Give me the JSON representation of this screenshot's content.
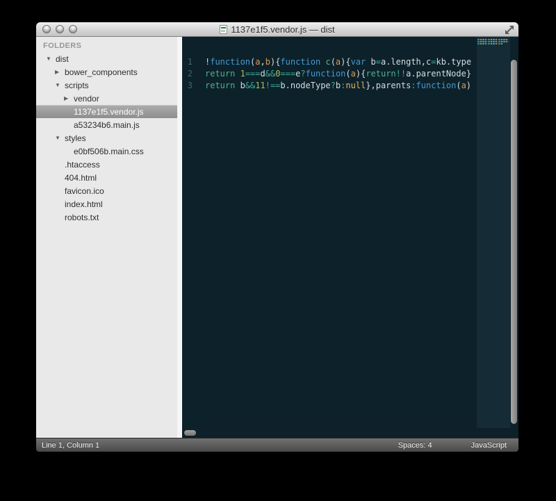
{
  "window": {
    "title": "1137e1f5.vendor.js — dist",
    "traffic_lights": [
      "close",
      "minimize",
      "zoom"
    ]
  },
  "sidebar": {
    "header": "FOLDERS",
    "items": [
      {
        "label": "dist",
        "level": 1,
        "type": "folder",
        "state": "expanded",
        "selected": false
      },
      {
        "label": "bower_components",
        "level": 2,
        "type": "folder",
        "state": "collapsed",
        "selected": false
      },
      {
        "label": "scripts",
        "level": 2,
        "type": "folder",
        "state": "expanded",
        "selected": false
      },
      {
        "label": "vendor",
        "level": 3,
        "type": "folder",
        "state": "collapsed",
        "selected": false
      },
      {
        "label": "1137e1f5.vendor.js",
        "level": 3,
        "type": "file",
        "state": "none",
        "selected": true
      },
      {
        "label": "a53234b6.main.js",
        "level": 3,
        "type": "file",
        "state": "none",
        "selected": false
      },
      {
        "label": "styles",
        "level": 2,
        "type": "folder",
        "state": "expanded",
        "selected": false
      },
      {
        "label": "e0bf506b.main.css",
        "level": 3,
        "type": "file",
        "state": "none",
        "selected": false
      },
      {
        "label": ".htaccess",
        "level": 2,
        "type": "file",
        "state": "none",
        "selected": false
      },
      {
        "label": "404.html",
        "level": 2,
        "type": "file",
        "state": "none",
        "selected": false
      },
      {
        "label": "favicon.ico",
        "level": 2,
        "type": "file",
        "state": "none",
        "selected": false
      },
      {
        "label": "index.html",
        "level": 2,
        "type": "file",
        "state": "none",
        "selected": false
      },
      {
        "label": "robots.txt",
        "level": 2,
        "type": "file",
        "state": "none",
        "selected": false
      }
    ]
  },
  "editor": {
    "colors": {
      "bg": "#0d212a",
      "gutter": "#3f6373",
      "plain": "#d5dde1",
      "kw": "#4499d4",
      "ret": "#4cb38a",
      "op": "#3cae97",
      "num": "#a2c25f",
      "param": "#db9a57",
      "const": "#e5b567",
      "fname": "#55b87b"
    },
    "lines": [
      {
        "number": "1",
        "tokens": [
          [
            "!",
            "plain"
          ],
          [
            "function",
            "kw"
          ],
          [
            "(",
            "plain"
          ],
          [
            "a",
            "param"
          ],
          [
            ",",
            "plain"
          ],
          [
            "b",
            "param"
          ],
          [
            "){",
            "plain"
          ],
          [
            "function",
            "kw"
          ],
          [
            " ",
            "plain"
          ],
          [
            "c",
            "fname"
          ],
          [
            "(",
            "plain"
          ],
          [
            "a",
            "param"
          ],
          [
            "){",
            "plain"
          ],
          [
            "var",
            "kw"
          ],
          [
            " b",
            "plain"
          ],
          [
            "=",
            "op"
          ],
          [
            "a.length,c",
            "plain"
          ],
          [
            "=",
            "op"
          ],
          [
            "kb.type",
            "plain"
          ]
        ]
      },
      {
        "number": "2",
        "tokens": [
          [
            "return",
            "ret"
          ],
          [
            " ",
            "plain"
          ],
          [
            "1",
            "num"
          ],
          [
            "===",
            "op"
          ],
          [
            "d",
            "plain"
          ],
          [
            "&&",
            "op"
          ],
          [
            "0",
            "num"
          ],
          [
            "===",
            "op"
          ],
          [
            "e",
            "plain"
          ],
          [
            "?",
            "op"
          ],
          [
            "function",
            "kw"
          ],
          [
            "(",
            "plain"
          ],
          [
            "a",
            "param"
          ],
          [
            "){",
            "plain"
          ],
          [
            "return",
            "ret"
          ],
          [
            "!!",
            "op"
          ],
          [
            "a.parentNode}",
            "plain"
          ]
        ]
      },
      {
        "number": "3",
        "tokens": [
          [
            "return",
            "ret"
          ],
          [
            " b",
            "plain"
          ],
          [
            "&&",
            "op"
          ],
          [
            "11",
            "num"
          ],
          [
            "!==",
            "op"
          ],
          [
            "b.nodeType",
            "plain"
          ],
          [
            "?",
            "op"
          ],
          [
            "b",
            "plain"
          ],
          [
            ":",
            "op"
          ],
          [
            "null",
            "const"
          ],
          [
            "},",
            "plain"
          ],
          [
            "parents",
            "plain"
          ],
          [
            ":",
            "op"
          ],
          [
            "function",
            "kw"
          ],
          [
            "(",
            "plain"
          ],
          [
            "a",
            "param"
          ],
          [
            ")",
            "plain"
          ]
        ]
      }
    ]
  },
  "status_bar": {
    "left": "Line 1, Column 1",
    "spaces": "Spaces: 4",
    "language": "JavaScript"
  }
}
